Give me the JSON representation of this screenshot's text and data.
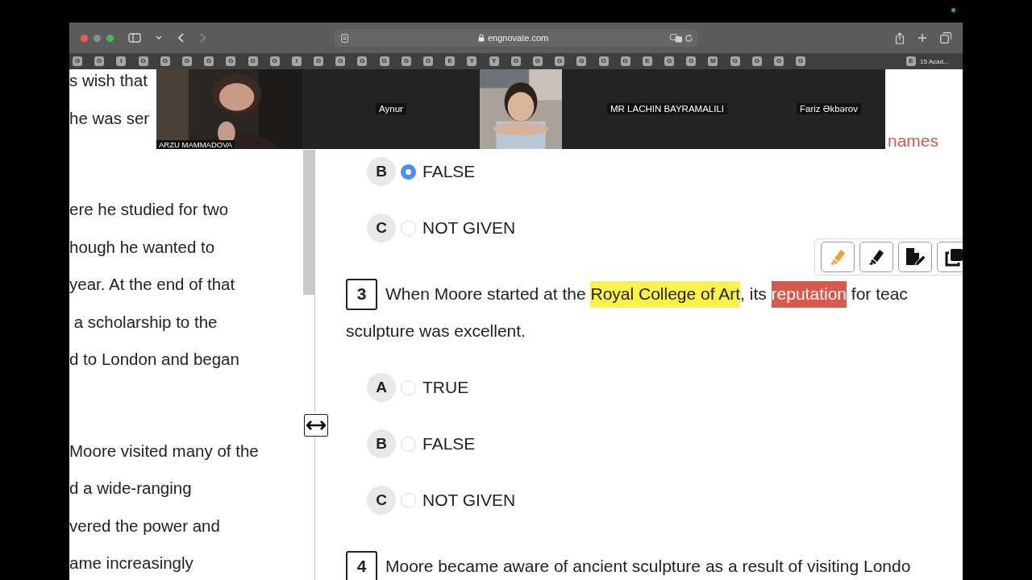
{
  "browser": {
    "url": "engnovate.com",
    "tabs": [
      "G",
      "G",
      "I",
      "G",
      "G",
      "G",
      "G",
      "G",
      "G",
      "G",
      "I",
      "G",
      "G",
      "G",
      "G",
      "G",
      "G",
      "E",
      "Y",
      "Y",
      "G",
      "G",
      "G",
      "G",
      "G",
      "G",
      "E",
      "G",
      "G",
      "M",
      "G",
      "G",
      "G",
      "G"
    ],
    "active_tab": {
      "letter": "E",
      "title": "15 Acad..."
    }
  },
  "video_call": {
    "participants": [
      {
        "kind": "camera",
        "name": "ARZU MAMMADOVA"
      },
      {
        "kind": "avatar",
        "name": "Aynur"
      },
      {
        "kind": "camera"
      },
      {
        "kind": "avatar",
        "name": "MR LACHIN BAYRAMALILI"
      },
      {
        "kind": "avatar",
        "name": "Fariz Əkbərov"
      }
    ]
  },
  "passage": [
    [
      "s wish that",
      "he was ser"
    ],
    [
      "ere he studied for two",
      "hough he wanted to",
      "year. At the end of that",
      " a scholarship to the",
      "d to London and began"
    ],
    [
      "Moore visited many of the",
      "d a wide-ranging",
      "vered the power and",
      "ame increasingly"
    ]
  ],
  "questions": [
    {
      "text": [
        {
          "text": "names",
          "highlighted": false
        }
      ],
      "options": [
        {
          "letter": "B",
          "label": "FALSE",
          "selected": true
        },
        {
          "letter": "C",
          "label": "NOT GIVEN",
          "selected": false
        }
      ]
    },
    {
      "number": "3",
      "text": [
        {
          "text": "When Moore started at the ",
          "highlighted": false
        },
        {
          "text": "Royal College of Art",
          "highlighted": true,
          "color": "#fbf24a"
        },
        {
          "text": ", its ",
          "highlighted": false
        },
        {
          "text": "reputation",
          "highlighted": true,
          "color": "#d9574b"
        },
        {
          "text": " for teac",
          "highlighted": false
        }
      ],
      "text_line_2": "sculpture was excellent.",
      "options": [
        {
          "letter": "A",
          "label": "TRUE",
          "selected": false
        },
        {
          "letter": "B",
          "label": "FALSE",
          "selected": false
        },
        {
          "letter": "C",
          "label": "NOT GIVEN",
          "selected": false
        }
      ]
    },
    {
      "number": "4",
      "text": [
        {
          "text": "Moore became aware of ancient sculpture as a result of visiting Londo",
          "highlighted": false
        }
      ]
    }
  ],
  "annotation_tools": [
    {
      "kind": "highlighter"
    },
    {
      "kind": "marker"
    },
    {
      "kind": "note"
    },
    {
      "kind": "copy"
    }
  ]
}
